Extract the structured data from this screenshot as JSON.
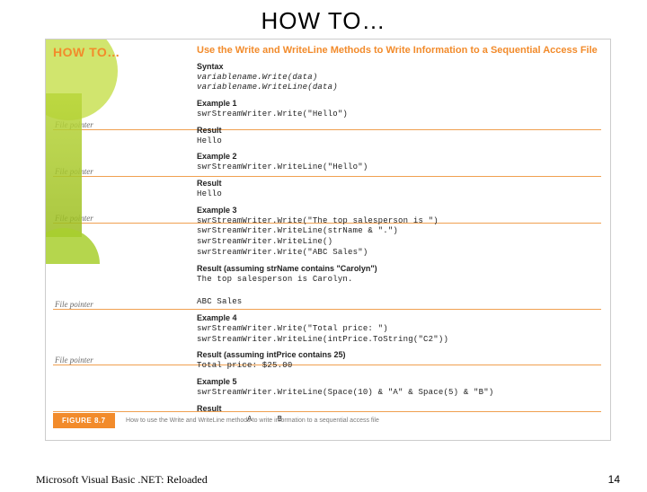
{
  "title": "HOW TO…",
  "howto_label": "HOW TO…",
  "topic": "Use the Write and WriteLine Methods to Write Information to a Sequential Access File",
  "syntax_h": "Syntax",
  "syntax_lines": [
    "variablename.Write(data)",
    "variablename.WriteLine(data)"
  ],
  "file_pointer_label": "File pointer",
  "examples": [
    {
      "h": "Example 1",
      "code": [
        "swrStreamWriter.Write(\"Hello\")"
      ],
      "result_h": "Result",
      "result": [
        "Hello"
      ]
    },
    {
      "h": "Example 2",
      "code": [
        "swrStreamWriter.WriteLine(\"Hello\")"
      ],
      "result_h": "Result",
      "result": [
        "Hello"
      ]
    },
    {
      "h": "Example 3",
      "code": [
        "swrStreamWriter.Write(\"The top salesperson is \")",
        "swrStreamWriter.WriteLine(strName & \".\")",
        "swrStreamWriter.WriteLine()",
        "swrStreamWriter.Write(\"ABC Sales\")"
      ],
      "result_h": "Result (assuming strName contains \"Carolyn\")",
      "result": [
        "The top salesperson is Carolyn.",
        "",
        "ABC Sales"
      ]
    },
    {
      "h": "Example 4",
      "code": [
        "swrStreamWriter.Write(\"Total price: \")",
        "swrStreamWriter.WriteLine(intPrice.ToString(\"C2\"))"
      ],
      "result_h": "Result (assuming intPrice contains 25)",
      "result": [
        "Total price: $25.00"
      ]
    },
    {
      "h": "Example 5",
      "code": [
        "swrStreamWriter.WriteLine(Space(10) & \"A\" & Space(5) & \"B\")"
      ],
      "result_h": "Result",
      "result": [
        "          A     B"
      ]
    }
  ],
  "caption_tag": "FIGURE 8.7",
  "caption_text": "How to use the Write and WriteLine methods to write information to a sequential access file",
  "footer_left": "Microsoft Visual Basic .NET: Reloaded",
  "footer_right": "14"
}
